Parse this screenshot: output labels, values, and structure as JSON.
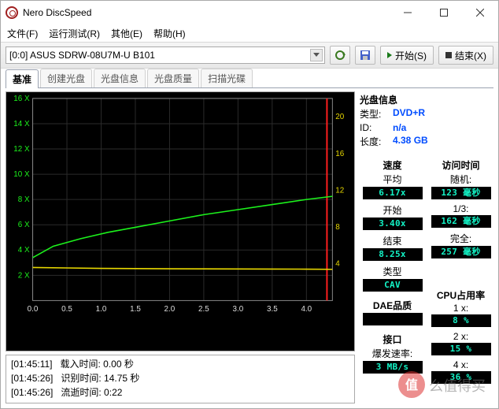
{
  "window": {
    "title": "Nero DiscSpeed"
  },
  "menu": {
    "file": "文件(F)",
    "run": "运行测试(R)",
    "other": "其他(E)",
    "help": "帮助(H)"
  },
  "toolbar": {
    "drive": "[0:0]   ASUS SDRW-08U7M-U B101",
    "start": "开始(S)",
    "end": "结束(X)"
  },
  "tabs": [
    "基准",
    "创建光盘",
    "光盘信息",
    "光盘质量",
    "扫描光碟"
  ],
  "chart_data": {
    "type": "line",
    "xlim": [
      0,
      4.38
    ],
    "ylim_left": [
      0,
      16
    ],
    "ylim_right": [
      0,
      22
    ],
    "left_ticks": [
      2,
      4,
      6,
      8,
      10,
      12,
      14,
      16
    ],
    "x_ticks": [
      0.0,
      0.5,
      1.0,
      1.5,
      2.0,
      2.5,
      3.0,
      3.5,
      4.0
    ],
    "right_ticks": [
      4,
      8,
      12,
      16,
      20
    ],
    "series": [
      {
        "name": "speed",
        "color": "#1CF21C",
        "axis": "left",
        "x": [
          0.0,
          0.3,
          0.7,
          1.1,
          1.5,
          2.0,
          2.5,
          3.0,
          3.5,
          4.0,
          4.38
        ],
        "y": [
          3.4,
          4.3,
          4.9,
          5.4,
          5.8,
          6.3,
          6.8,
          7.2,
          7.6,
          8.0,
          8.25
        ]
      },
      {
        "name": "rotation",
        "color": "#E8D800",
        "axis": "right",
        "x": [
          0.0,
          0.5,
          1.0,
          1.5,
          2.0,
          2.5,
          3.0,
          3.5,
          4.0,
          4.38
        ],
        "y": [
          3.6,
          3.55,
          3.5,
          3.48,
          3.46,
          3.45,
          3.44,
          3.43,
          3.42,
          3.4
        ]
      }
    ],
    "marker_x": 4.3
  },
  "log": [
    {
      "t": "[01:45:11]",
      "txt": "载入时间: 0.00 秒"
    },
    {
      "t": "[01:45:26]",
      "txt": "识别时间: 14.75 秒"
    },
    {
      "t": "[01:45:26]",
      "txt": "流逝时间: 0:22"
    }
  ],
  "info": {
    "hdr": "光盘信息",
    "type_k": "类型:",
    "type_v": "DVD+R",
    "id_k": "ID:",
    "id_v": "n/a",
    "len_k": "长度:",
    "len_v": "4.38 GB"
  },
  "speed": {
    "hdr_l": "速度",
    "hdr_r": "访问时间",
    "avg_l": "平均",
    "avg_v": "6.17x",
    "rnd_l": "随机:",
    "rnd_v": "123 毫秒",
    "start_l": "开始",
    "start_v": "3.40x",
    "third_l": "1/3:",
    "third_v": "162 毫秒",
    "end_l": "结束",
    "end_v": "8.25x",
    "full_l": "完全:",
    "full_v": "257 毫秒",
    "type_l": "类型",
    "type_v": "CAV"
  },
  "cpu": {
    "hdr": "CPU占用率",
    "l1": "1 x:",
    "v1": "8 %",
    "l2": "2 x:",
    "v2": "15 %",
    "l4": "4 x:",
    "v4": "36 %"
  },
  "dae": {
    "hdr": "DAE品质",
    "val": ""
  },
  "iface": {
    "hdr": "接口",
    "rate_l": "爆发速率:",
    "rate_v": "3 MB/s"
  },
  "watermark_text": "么值得买"
}
